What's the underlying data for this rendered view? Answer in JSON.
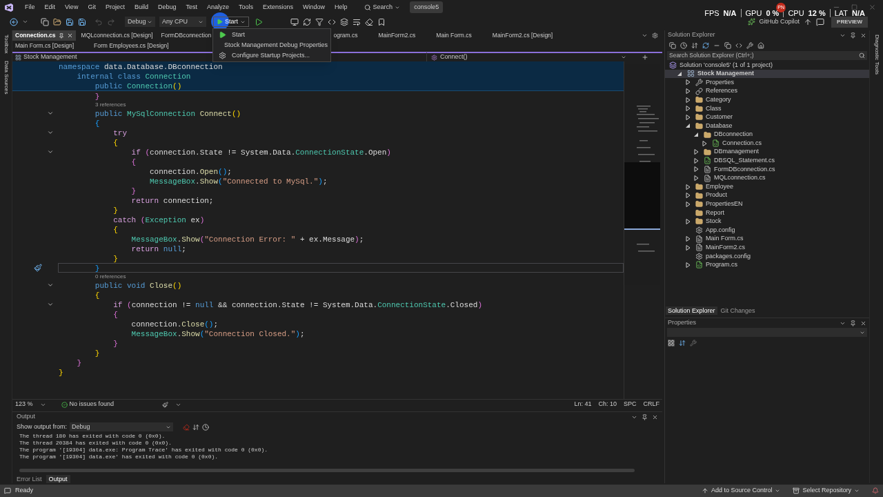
{
  "menu_bar": {
    "items": [
      "File",
      "Edit",
      "View",
      "Git",
      "Project",
      "Build",
      "Debug",
      "Test",
      "Analyze",
      "Tools",
      "Extensions",
      "Window",
      "Help"
    ],
    "search": "Search",
    "solution_name": "console5"
  },
  "performance_overlay": {
    "badge": "PN",
    "stats": [
      {
        "label": "FPS",
        "value": "N/A"
      },
      {
        "label": "GPU",
        "value": "0 %"
      },
      {
        "label": "CPU",
        "value": "12 %"
      },
      {
        "label": "LAT",
        "value": "N/A"
      }
    ]
  },
  "toolbar": {
    "configuration": "Debug",
    "platform": "Any CPU",
    "start": "Start",
    "copilot": "GitHub Copilot",
    "preview": "PREVIEW"
  },
  "start_menu": [
    {
      "kind": "start",
      "label": "Start"
    },
    {
      "kind": "properties",
      "label": "Stock Management Debug Properties"
    },
    {
      "kind": "configure",
      "label": "Configure Startup Projects..."
    }
  ],
  "left_strip": [
    "Toolbox",
    "Data Sources"
  ],
  "right_strip": [
    "Diagnostic Tools"
  ],
  "tab_rows": [
    {
      "tabs": [
        {
          "label": "Connection.cs",
          "selected": true
        },
        {
          "label": "MQLconnection.cs [Design]",
          "selected": false
        },
        {
          "label": "FormDBconnection",
          "selected": false
        },
        {
          "label": "ogram.cs",
          "selected": false
        },
        {
          "label": "MainForm2.cs",
          "selected": false
        },
        {
          "label": "Main Form.cs",
          "selected": false
        },
        {
          "label": "MainForm2.cs [Design]",
          "selected": false
        }
      ]
    },
    {
      "tabs": [
        {
          "label": "Main Form.cs [Design]",
          "selected": false
        },
        {
          "label": "Form Employees.cs [Design]",
          "selected": false
        }
      ]
    }
  ],
  "nav_bar": {
    "project": "Stock Management",
    "member": "Connect()"
  },
  "editor": {
    "sticky": [
      {
        "tokens": [
          {
            "kind": "kw",
            "text": "namespace "
          },
          {
            "kind": "plain",
            "text": "data.Database.DBconnection"
          }
        ]
      },
      {
        "tokens": [
          {
            "kind": "kw",
            "text": "    internal class "
          },
          {
            "kind": "type",
            "text": "Connection"
          }
        ]
      },
      {
        "tokens": [
          {
            "kind": "kw",
            "text": "        public "
          },
          {
            "kind": "type",
            "text": "Connection"
          },
          {
            "kind": "b1",
            "text": "()"
          }
        ]
      }
    ],
    "lines": [
      {
        "kind": "code",
        "fold": false,
        "current": false,
        "tokens": [
          {
            "kind": "b2",
            "text": "        }"
          }
        ]
      },
      {
        "kind": "lens",
        "text": "3 references"
      },
      {
        "kind": "code",
        "fold": true,
        "current": false,
        "tokens": [
          {
            "kind": "kw",
            "text": "        public "
          },
          {
            "kind": "type",
            "text": "MySqlConnection "
          },
          {
            "kind": "method",
            "text": "Connect"
          },
          {
            "kind": "b1",
            "text": "()"
          }
        ]
      },
      {
        "kind": "code",
        "fold": false,
        "current": false,
        "tokens": [
          {
            "kind": "b3",
            "text": "        {"
          }
        ]
      },
      {
        "kind": "code",
        "fold": true,
        "current": false,
        "tokens": [
          {
            "kind": "ctl",
            "text": "            try"
          }
        ]
      },
      {
        "kind": "code",
        "fold": false,
        "current": false,
        "tokens": [
          {
            "kind": "b1",
            "text": "            {"
          }
        ]
      },
      {
        "kind": "code",
        "fold": true,
        "current": false,
        "tokens": [
          {
            "kind": "ctl",
            "text": "                if "
          },
          {
            "kind": "b2",
            "text": "("
          },
          {
            "kind": "plain",
            "text": "connection.State != System.Data."
          },
          {
            "kind": "type",
            "text": "ConnectionState"
          },
          {
            "kind": "plain",
            "text": ".Open"
          },
          {
            "kind": "b2",
            "text": ")"
          }
        ]
      },
      {
        "kind": "code",
        "fold": false,
        "current": false,
        "tokens": [
          {
            "kind": "b2",
            "text": "                {"
          }
        ]
      },
      {
        "kind": "code",
        "fold": false,
        "current": false,
        "tokens": [
          {
            "kind": "plain",
            "text": "                    connection."
          },
          {
            "kind": "method",
            "text": "Open"
          },
          {
            "kind": "b3",
            "text": "()"
          },
          {
            "kind": "plain",
            "text": ";"
          }
        ]
      },
      {
        "kind": "code",
        "fold": false,
        "current": false,
        "tokens": [
          {
            "kind": "type",
            "text": "                    MessageBox"
          },
          {
            "kind": "plain",
            "text": "."
          },
          {
            "kind": "method",
            "text": "Show"
          },
          {
            "kind": "b3",
            "text": "("
          },
          {
            "kind": "str",
            "text": "\"Connected to MySql.\""
          },
          {
            "kind": "b3",
            "text": ")"
          },
          {
            "kind": "plain",
            "text": ";"
          }
        ]
      },
      {
        "kind": "code",
        "fold": false,
        "current": false,
        "tokens": [
          {
            "kind": "b2",
            "text": "                }"
          }
        ]
      },
      {
        "kind": "code",
        "fold": false,
        "current": false,
        "tokens": [
          {
            "kind": "ctl",
            "text": "                return "
          },
          {
            "kind": "plain",
            "text": "connection;"
          }
        ]
      },
      {
        "kind": "code",
        "fold": false,
        "current": false,
        "tokens": [
          {
            "kind": "b1",
            "text": "            }"
          }
        ]
      },
      {
        "kind": "code",
        "fold": false,
        "current": false,
        "tokens": [
          {
            "kind": "ctl",
            "text": "            catch "
          },
          {
            "kind": "b2",
            "text": "("
          },
          {
            "kind": "type",
            "text": "Exception "
          },
          {
            "kind": "plain",
            "text": "ex"
          },
          {
            "kind": "b2",
            "text": ")"
          }
        ]
      },
      {
        "kind": "code",
        "fold": false,
        "current": false,
        "tokens": [
          {
            "kind": "b1",
            "text": "            {"
          }
        ]
      },
      {
        "kind": "code",
        "fold": false,
        "current": false,
        "tokens": [
          {
            "kind": "type",
            "text": "                MessageBox"
          },
          {
            "kind": "plain",
            "text": "."
          },
          {
            "kind": "method",
            "text": "Show"
          },
          {
            "kind": "b2",
            "text": "("
          },
          {
            "kind": "str",
            "text": "\"Connection Error: \" "
          },
          {
            "kind": "plain",
            "text": "+ ex.Message"
          },
          {
            "kind": "b2",
            "text": ")"
          },
          {
            "kind": "plain",
            "text": ";"
          }
        ]
      },
      {
        "kind": "code",
        "fold": false,
        "current": false,
        "tokens": [
          {
            "kind": "ctl",
            "text": "                return "
          },
          {
            "kind": "kw",
            "text": "null"
          },
          {
            "kind": "plain",
            "text": ";"
          }
        ]
      },
      {
        "kind": "code",
        "fold": false,
        "current": false,
        "tokens": [
          {
            "kind": "b1",
            "text": "            }"
          }
        ]
      },
      {
        "kind": "code",
        "fold": false,
        "current": true,
        "tokens": [
          {
            "kind": "b3",
            "text": "        }"
          }
        ]
      },
      {
        "kind": "lens",
        "text": "0 references"
      },
      {
        "kind": "code",
        "fold": true,
        "current": false,
        "tokens": [
          {
            "kind": "kw",
            "text": "        public void "
          },
          {
            "kind": "method",
            "text": "Close"
          },
          {
            "kind": "b1",
            "text": "()"
          }
        ]
      },
      {
        "kind": "code",
        "fold": false,
        "current": false,
        "tokens": [
          {
            "kind": "b1",
            "text": "        {"
          }
        ]
      },
      {
        "kind": "code",
        "fold": true,
        "current": false,
        "tokens": [
          {
            "kind": "ctl",
            "text": "            if "
          },
          {
            "kind": "b2",
            "text": "("
          },
          {
            "kind": "plain",
            "text": "connection != "
          },
          {
            "kind": "kw",
            "text": "null "
          },
          {
            "kind": "plain",
            "text": "&& connection.State != System.Data."
          },
          {
            "kind": "type",
            "text": "ConnectionState"
          },
          {
            "kind": "plain",
            "text": ".Closed"
          },
          {
            "kind": "b2",
            "text": ")"
          }
        ]
      },
      {
        "kind": "code",
        "fold": false,
        "current": false,
        "tokens": [
          {
            "kind": "b2",
            "text": "            {"
          }
        ]
      },
      {
        "kind": "code",
        "fold": false,
        "current": false,
        "tokens": [
          {
            "kind": "plain",
            "text": "                connection."
          },
          {
            "kind": "method",
            "text": "Close"
          },
          {
            "kind": "b3",
            "text": "()"
          },
          {
            "kind": "plain",
            "text": ";"
          }
        ]
      },
      {
        "kind": "code",
        "fold": false,
        "current": false,
        "tokens": [
          {
            "kind": "type",
            "text": "                MessageBox"
          },
          {
            "kind": "plain",
            "text": "."
          },
          {
            "kind": "method",
            "text": "Show"
          },
          {
            "kind": "b3",
            "text": "("
          },
          {
            "kind": "str",
            "text": "\"Connection Closed.\""
          },
          {
            "kind": "b3",
            "text": ")"
          },
          {
            "kind": "plain",
            "text": ";"
          }
        ]
      },
      {
        "kind": "code",
        "fold": false,
        "current": false,
        "tokens": [
          {
            "kind": "b2",
            "text": "            }"
          }
        ]
      },
      {
        "kind": "code",
        "fold": false,
        "current": false,
        "tokens": [
          {
            "kind": "b1",
            "text": "        }"
          }
        ]
      },
      {
        "kind": "code",
        "fold": false,
        "current": false,
        "tokens": [
          {
            "kind": "b2",
            "text": "    }"
          }
        ]
      },
      {
        "kind": "code",
        "fold": false,
        "current": false,
        "tokens": [
          {
            "kind": "b1",
            "text": "}"
          }
        ]
      }
    ],
    "zoom": "123 %",
    "issues": "No issues found",
    "line": "Ln: 41",
    "column": "Ch: 10",
    "whitespace": "SPC",
    "line_endings": "CRLF"
  },
  "output": {
    "title": "Output",
    "source_label": "Show output from:",
    "source": "Debug",
    "lines": [
      "The thread 180 has exited with code 0 (0x0).",
      "The thread 20384 has exited with code 0 (0x0).",
      "The program '[19304] data.exe: Program Trace' has exited with code 0 (0x0).",
      "The program '[19304] data.exe' has exited with code 0 (0x0)."
    ],
    "tabs": [
      {
        "label": "Error List",
        "selected": false
      },
      {
        "label": "Output",
        "selected": true
      }
    ]
  },
  "solution_explorer": {
    "title": "Solution Explorer",
    "search_placeholder": "Search Solution Explorer (Ctrl+;)",
    "tree": [
      {
        "kind": "solution",
        "label": "Solution 'console5' (1 of 1 project)",
        "selected": false,
        "children": [
          {
            "kind": "project",
            "label": "Stock Management",
            "expanded": true,
            "selected": true,
            "children": [
              {
                "kind": "properties",
                "label": "Properties",
                "expanded": false,
                "selected": false
              },
              {
                "kind": "references",
                "label": "References",
                "expanded": false,
                "selected": false
              },
              {
                "kind": "folder",
                "label": "Category",
                "expanded": false,
                "selected": false
              },
              {
                "kind": "folder",
                "label": "Class",
                "expanded": false,
                "selected": false
              },
              {
                "kind": "folder",
                "label": "Customer",
                "expanded": false,
                "selected": false
              },
              {
                "kind": "folder",
                "label": "Database",
                "expanded": true,
                "selected": false,
                "children": [
                  {
                    "kind": "folder",
                    "label": "DBconnection",
                    "expanded": true,
                    "selected": false,
                    "children": [
                      {
                        "kind": "csharp",
                        "label": "Connection.cs",
                        "expanded": false,
                        "selected": false
                      }
                    ]
                  },
                  {
                    "kind": "folder",
                    "label": "DBmanagement",
                    "expanded": false,
                    "selected": false
                  },
                  {
                    "kind": "csharp",
                    "label": "DBSQL_Statement.cs",
                    "expanded": false,
                    "selected": false
                  },
                  {
                    "kind": "form",
                    "label": "FormDBconnection.cs",
                    "expanded": false,
                    "selected": false
                  },
                  {
                    "kind": "form",
                    "label": "MQLconnection.cs",
                    "expanded": false,
                    "selected": false
                  }
                ]
              },
              {
                "kind": "folder",
                "label": "Employee",
                "expanded": false,
                "selected": false
              },
              {
                "kind": "folder",
                "label": "Product",
                "expanded": false,
                "selected": false
              },
              {
                "kind": "folder",
                "label": "PropertiesEN",
                "expanded": false,
                "selected": false
              },
              {
                "kind": "folder",
                "label": "Report",
                "selected": false
              },
              {
                "kind": "folder",
                "label": "Stock",
                "expanded": false,
                "selected": false
              },
              {
                "kind": "config",
                "label": "App.config",
                "selected": false
              },
              {
                "kind": "form",
                "label": "Main Form.cs",
                "expanded": false,
                "selected": false
              },
              {
                "kind": "form",
                "label": "MainForm2.cs",
                "expanded": false,
                "selected": false
              },
              {
                "kind": "config",
                "label": "packages.config",
                "selected": false
              },
              {
                "kind": "csharp",
                "label": "Program.cs",
                "expanded": false,
                "selected": false
              }
            ]
          }
        ]
      }
    ],
    "tabs": [
      {
        "label": "Solution Explorer",
        "selected": true
      },
      {
        "label": "Git Changes",
        "selected": false
      }
    ]
  },
  "properties": {
    "title": "Properties"
  },
  "status_bar": {
    "status": "Ready",
    "source_control": "Add to Source Control",
    "repository": "Select Repository"
  }
}
